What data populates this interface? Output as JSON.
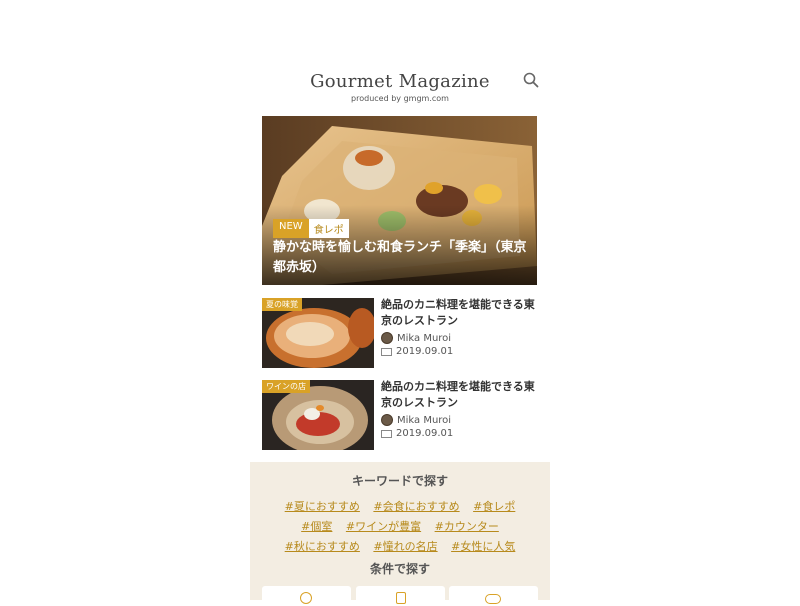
{
  "header": {
    "logo": "Gourmet Magazine",
    "tagline": "produced by gmgm.com",
    "search_icon": "search-icon"
  },
  "hero": {
    "badge_new": "NEW",
    "badge_category": "食レポ",
    "title": "静かな時を愉しむ和食ランチ「季楽」（東京都赤坂）"
  },
  "articles": [
    {
      "tag": "夏の味覚",
      "title": "絶品のカニ料理を堪能できる東京のレストラン",
      "author": "Mika Muroi",
      "date": "2019.09.01"
    },
    {
      "tag": "ワインの店",
      "title": "絶品のカニ料理を堪能できる東京のレストラン",
      "author": "Mika Muroi",
      "date": "2019.09.01"
    }
  ],
  "keywords": {
    "heading": "キーワードで探す",
    "rows": [
      [
        "#夏におすすめ",
        "#会食におすすめ",
        "#食レポ"
      ],
      [
        "#個室",
        "#ワインが豊富",
        "#カウンター"
      ],
      [
        "#秋におすすめ",
        "#憧れの名店",
        "#女性に人気"
      ]
    ]
  },
  "conditions": {
    "heading": "条件で探す"
  },
  "colors": {
    "accent": "#d9a227",
    "panel_bg": "#f3ede2"
  }
}
